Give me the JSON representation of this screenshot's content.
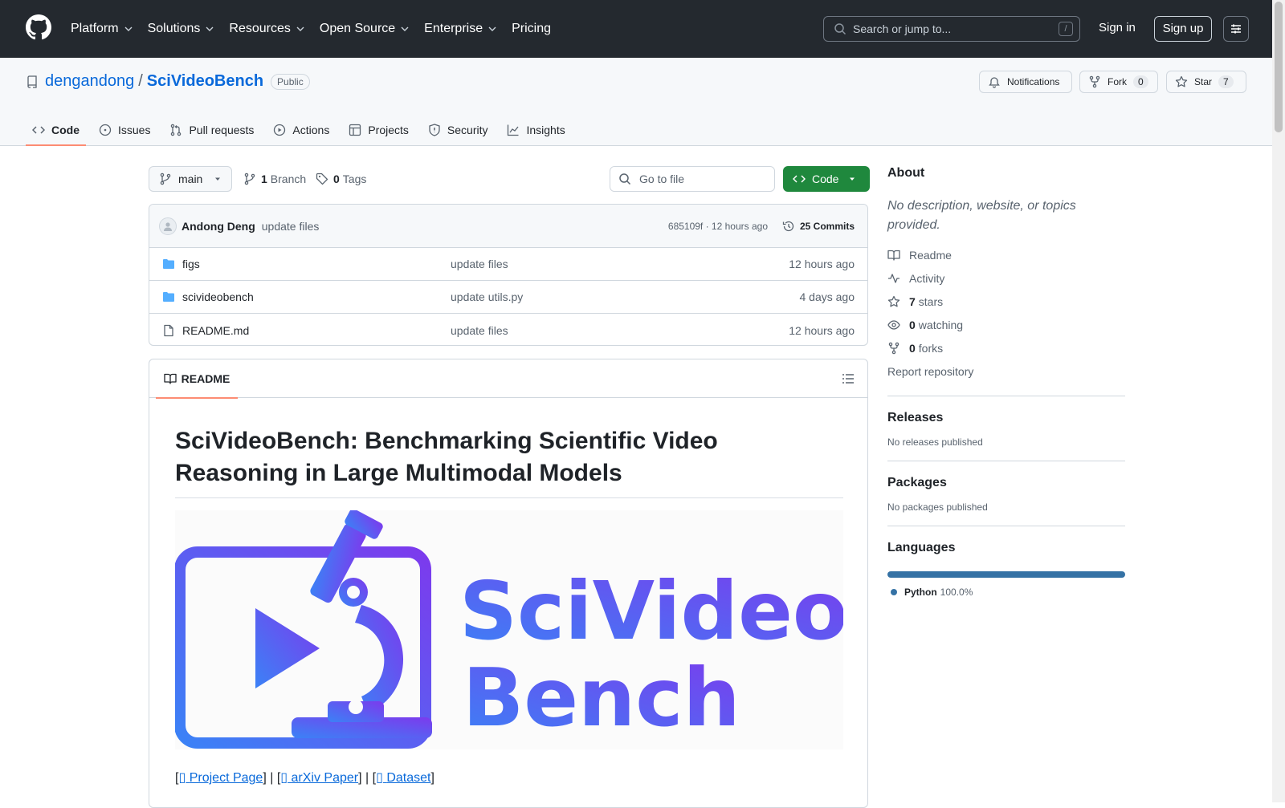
{
  "header": {
    "nav": [
      {
        "label": "Platform",
        "dropdown": true
      },
      {
        "label": "Solutions",
        "dropdown": true
      },
      {
        "label": "Resources",
        "dropdown": true
      },
      {
        "label": "Open Source",
        "dropdown": true
      },
      {
        "label": "Enterprise",
        "dropdown": true
      },
      {
        "label": "Pricing",
        "dropdown": false
      }
    ],
    "search_placeholder": "Search or jump to...",
    "search_shortcut": "/",
    "sign_in": "Sign in",
    "sign_up": "Sign up"
  },
  "repo": {
    "owner": "dengandong",
    "separator": "/",
    "name": "SciVideoBench",
    "visibility": "Public",
    "notifications_label": "Notifications",
    "fork_label": "Fork",
    "fork_count": "0",
    "star_label": "Star",
    "star_count": "7",
    "tabs": [
      {
        "label": "Code",
        "icon": "code-icon",
        "active": true
      },
      {
        "label": "Issues",
        "icon": "issue-icon",
        "active": false
      },
      {
        "label": "Pull requests",
        "icon": "pull-request-icon",
        "active": false
      },
      {
        "label": "Actions",
        "icon": "play-icon",
        "active": false
      },
      {
        "label": "Projects",
        "icon": "table-icon",
        "active": false
      },
      {
        "label": "Security",
        "icon": "shield-icon",
        "active": false
      },
      {
        "label": "Insights",
        "icon": "graph-icon",
        "active": false
      }
    ]
  },
  "branch_bar": {
    "branch": "main",
    "branch_count": "1",
    "branch_label": "Branch",
    "tag_count": "0",
    "tag_label": "Tags",
    "go_to_file": "Go to file",
    "code_button": "Code"
  },
  "latest_commit": {
    "author": "Andong Deng",
    "message": "update files",
    "meta": "685109f · 12 hours ago",
    "commits_label": "25 Commits"
  },
  "files": [
    {
      "name": "figs",
      "type": "folder",
      "message": "update files",
      "time": "12 hours ago"
    },
    {
      "name": "scivideobench",
      "type": "folder",
      "message": "update utils.py",
      "time": "4 days ago"
    },
    {
      "name": "README.md",
      "type": "file",
      "message": "update files",
      "time": "12 hours ago"
    }
  ],
  "readme": {
    "tab_label": "README",
    "heading": "SciVideoBench: Benchmarking Scientific Video Reasoning in Large Multimodal Models",
    "banner_text_line1": "SciVideo",
    "banner_text_line2": "Bench",
    "links": [
      {
        "label": "Project Page"
      },
      {
        "label": "arXiv Paper"
      },
      {
        "label": "Dataset"
      }
    ],
    "link_glyph": "▯"
  },
  "about": {
    "title": "About",
    "description": "No description, website, or topics provided.",
    "items": [
      {
        "icon": "book-icon",
        "count": "",
        "label": "Readme"
      },
      {
        "icon": "pulse-icon",
        "count": "",
        "label": "Activity"
      },
      {
        "icon": "star-icon",
        "count": "7",
        "label": "stars"
      },
      {
        "icon": "eye-icon",
        "count": "0",
        "label": "watching"
      },
      {
        "icon": "fork-icon",
        "count": "0",
        "label": "forks"
      }
    ],
    "report": "Report repository"
  },
  "releases": {
    "title": "Releases",
    "empty": "No releases published"
  },
  "packages": {
    "title": "Packages",
    "empty": "No packages published"
  },
  "languages": {
    "title": "Languages",
    "items": [
      {
        "name": "Python",
        "percent": "100.0%",
        "color": "#3572A5",
        "fraction": 1.0
      }
    ]
  },
  "colors": {
    "header_bg": "#24292f",
    "link": "#0969da",
    "code_button": "#1f883d",
    "active_tab_underline": "#fd8c73",
    "banner_gradient_start": "#3b82f6",
    "banner_gradient_end": "#7c3aed"
  }
}
